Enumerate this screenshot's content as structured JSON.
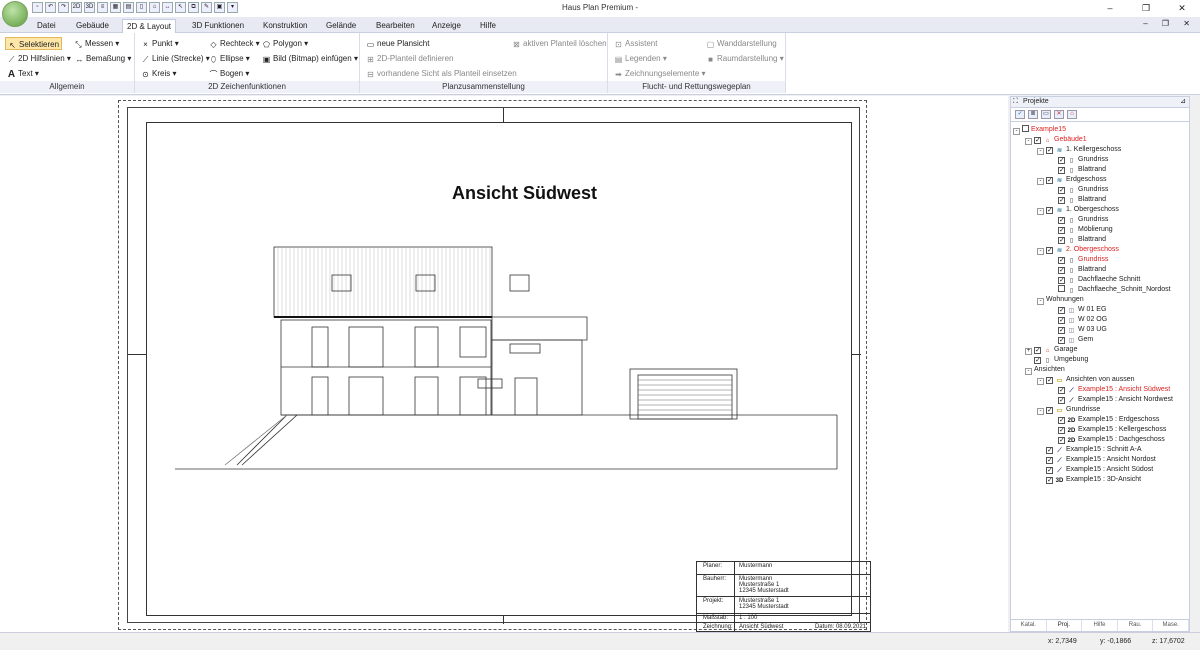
{
  "window": {
    "title": "Haus Plan Premium -"
  },
  "menu_tabs": [
    "Datei",
    "Gebäude",
    "2D & Layout",
    "3D Funktionen",
    "Konstruktion",
    "Gelände",
    "Bearbeiten",
    "Anzeige",
    "Hilfe"
  ],
  "active_tab": "2D & Layout",
  "ribbon": {
    "allgemein": {
      "label": "Allgemein",
      "selektieren": "Selektieren",
      "messen": "Messen",
      "hilfslinien": "2D Hilfslinien",
      "bemassung": "Bemaßung",
      "text": "Text"
    },
    "zeichen": {
      "label": "2D Zeichenfunktionen",
      "punkt": "Punkt",
      "rechteck": "Rechteck",
      "polygon": "Polygon",
      "linie": "Linie (Strecke)",
      "ellipse": "Ellipse",
      "bild": "Bild (Bitmap) einfügen",
      "kreis": "Kreis",
      "bogen": "Bogen"
    },
    "plan": {
      "label": "Planzusammenstellung",
      "neuer_plansicht": "neue Plansicht",
      "aktiven_loeschen": "aktiven Planteil löschen",
      "definieren": "2D-Planteil definieren",
      "einsetzen": "vorhandene Sicht als Planteil einsetzen"
    },
    "flucht": {
      "label": "Flucht- und Rettungswegeplan",
      "assistent": "Assistent",
      "wanddarstellung": "Wanddarstellung",
      "legenden": "Legenden",
      "raumdarstellung": "Raumdarstellung",
      "zeichnungselemente": "Zeichnungselemente"
    }
  },
  "drawing": {
    "title": "Ansicht Südwest",
    "titleblock": {
      "planer_label": "Planer:",
      "planer": "Mustermann",
      "bauherr_label": "Bauherr:",
      "bauherr": [
        "Mustermann",
        "Musterstraße 1",
        "12345 Musterstadt"
      ],
      "projekt_label": "Projekt:",
      "projekt": [
        "Musterstraße 1",
        "12345 Musterstadt"
      ],
      "massstab_label": "Maßstab:",
      "massstab": "1 : 100",
      "zeichnung_label": "Zeichnung:",
      "zeichnung": "Ansicht Südwest",
      "datum": "Datum: 08.09.2021"
    }
  },
  "panel": {
    "title": "Projekte",
    "tree": [
      {
        "d": 0,
        "text": "Example15",
        "red": true,
        "ex": "-",
        "cb": false,
        "icon": ""
      },
      {
        "d": 1,
        "text": "Gebäude1",
        "red": true,
        "ex": "-",
        "cb": true,
        "icon": "house"
      },
      {
        "d": 2,
        "text": "1. Kellergeschoss",
        "ex": "-",
        "cb": true,
        "icon": "floor"
      },
      {
        "d": 3,
        "text": "Grundriss",
        "cb": true,
        "icon": "page"
      },
      {
        "d": 3,
        "text": "Blattrand",
        "cb": true,
        "icon": "page"
      },
      {
        "d": 2,
        "text": "Erdgeschoss",
        "ex": "-",
        "cb": true,
        "icon": "floor"
      },
      {
        "d": 3,
        "text": "Grundriss",
        "cb": true,
        "icon": "page"
      },
      {
        "d": 3,
        "text": "Blattrand",
        "cb": true,
        "icon": "page"
      },
      {
        "d": 2,
        "text": "1. Obergeschoss",
        "ex": "-",
        "cb": true,
        "icon": "floor"
      },
      {
        "d": 3,
        "text": "Grundriss",
        "cb": true,
        "icon": "page"
      },
      {
        "d": 3,
        "text": "Möblierung",
        "cb": true,
        "icon": "page"
      },
      {
        "d": 3,
        "text": "Blattrand",
        "cb": true,
        "icon": "page"
      },
      {
        "d": 2,
        "text": "2. Obergeschoss",
        "red": true,
        "ex": "-",
        "cb": true,
        "icon": "floor"
      },
      {
        "d": 3,
        "text": "Grundriss",
        "red": true,
        "cb": true,
        "icon": "page"
      },
      {
        "d": 3,
        "text": "Blattrand",
        "cb": true,
        "icon": "page"
      },
      {
        "d": 3,
        "text": "Dachflaeche Schnitt",
        "cb": true,
        "icon": "page"
      },
      {
        "d": 3,
        "text": "Dachflaeche_Schnitt_Nordost",
        "cb": false,
        "icon": "page"
      },
      {
        "d": 2,
        "text": "Wohnungen",
        "ex": "-",
        "cb": null,
        "icon": ""
      },
      {
        "d": 3,
        "text": "W 01 EG",
        "cb": true,
        "icon": "flat"
      },
      {
        "d": 3,
        "text": "W 02 OG",
        "cb": true,
        "icon": "flat"
      },
      {
        "d": 3,
        "text": "W 03 UG",
        "cb": true,
        "icon": "flat"
      },
      {
        "d": 3,
        "text": "Gem",
        "cb": true,
        "icon": "flat"
      },
      {
        "d": 1,
        "text": "Garage",
        "ex": "+",
        "cb": true,
        "icon": "house"
      },
      {
        "d": 1,
        "text": "Umgebung",
        "cb": true,
        "icon": "page"
      },
      {
        "d": 1,
        "text": "Ansichten",
        "ex": "-",
        "cb": null,
        "icon": ""
      },
      {
        "d": 2,
        "text": "Ansichten von aussen",
        "ex": "-",
        "cb": true,
        "icon": "folder"
      },
      {
        "d": 3,
        "text": "Example15 : Ansicht Südwest",
        "red": true,
        "cb": true,
        "icon": "view"
      },
      {
        "d": 3,
        "text": "Example15 : Ansicht Nordwest",
        "cb": true,
        "icon": "view"
      },
      {
        "d": 2,
        "text": "Grundrisse",
        "ex": "-",
        "cb": true,
        "icon": "folder"
      },
      {
        "d": 3,
        "text": "Example15 : Erdgeschoss",
        "cb": true,
        "icon": "2d"
      },
      {
        "d": 3,
        "text": "Example15 : Kellergeschoss",
        "cb": true,
        "icon": "2d"
      },
      {
        "d": 3,
        "text": "Example15 : Dachgeschoss",
        "cb": true,
        "icon": "2d"
      },
      {
        "d": 2,
        "text": "Example15 : Schnitt A-A",
        "cb": true,
        "icon": "view"
      },
      {
        "d": 2,
        "text": "Example15 : Ansicht Nordost",
        "cb": true,
        "icon": "view"
      },
      {
        "d": 2,
        "text": "Example15 : Ansicht Südost",
        "cb": true,
        "icon": "view"
      },
      {
        "d": 2,
        "text": "Example15 : 3D-Ansicht",
        "cb": true,
        "icon": "3d"
      }
    ],
    "bottom_tabs": [
      "Katal.",
      "Proj.",
      "Hilfe",
      "Rau.",
      "Mase."
    ]
  },
  "status": {
    "x": "x: 2,7349",
    "y": "y: -0,1866",
    "z": "z: 17,6702"
  }
}
